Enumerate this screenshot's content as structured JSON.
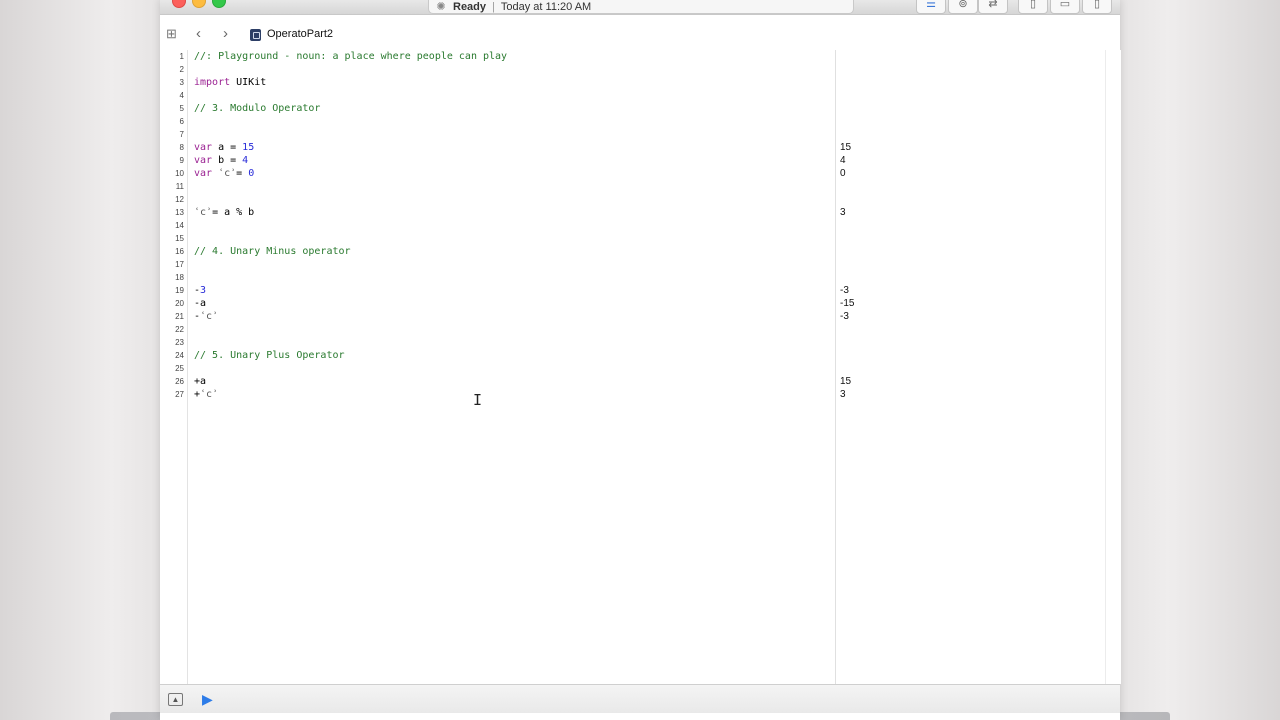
{
  "window": {
    "activity_status": "Ready",
    "activity_time": "Today at 11:20 AM"
  },
  "jumpbar": {
    "file_name": "OperatoPart2"
  },
  "editor": {
    "lines": [
      {
        "n": "1",
        "segments": [
          {
            "t": "//: Playground - noun: a place where people can play",
            "c": "comment"
          }
        ]
      },
      {
        "n": "2",
        "segments": []
      },
      {
        "n": "3",
        "segments": [
          {
            "t": "import",
            "c": "kw"
          },
          {
            "t": " UIKit",
            "c": "var"
          }
        ]
      },
      {
        "n": "4",
        "segments": []
      },
      {
        "n": "5",
        "segments": [
          {
            "t": "// 3. Modulo Operator",
            "c": "comment"
          }
        ]
      },
      {
        "n": "6",
        "segments": []
      },
      {
        "n": "7",
        "segments": []
      },
      {
        "n": "8",
        "segments": [
          {
            "t": "var",
            "c": "kw"
          },
          {
            "t": " a = ",
            "c": "var"
          },
          {
            "t": "15",
            "c": "num"
          }
        ]
      },
      {
        "n": "9",
        "segments": [
          {
            "t": "var",
            "c": "kw"
          },
          {
            "t": " b = ",
            "c": "var"
          },
          {
            "t": "4",
            "c": "num"
          }
        ]
      },
      {
        "n": "10",
        "segments": [
          {
            "t": "var",
            "c": "kw"
          },
          {
            "t": " ",
            "c": "var"
          },
          {
            "t": "ʿcʾ",
            "c": "warn"
          },
          {
            "t": "= ",
            "c": "var"
          },
          {
            "t": "0",
            "c": "num"
          }
        ]
      },
      {
        "n": "11",
        "segments": []
      },
      {
        "n": "12",
        "segments": []
      },
      {
        "n": "13",
        "segments": [
          {
            "t": "ʿcʾ",
            "c": "warn"
          },
          {
            "t": "= a % b",
            "c": "var"
          }
        ]
      },
      {
        "n": "14",
        "segments": []
      },
      {
        "n": "15",
        "segments": []
      },
      {
        "n": "16",
        "segments": [
          {
            "t": "// 4. Unary Minus operator",
            "c": "comment"
          }
        ]
      },
      {
        "n": "17",
        "segments": []
      },
      {
        "n": "18",
        "segments": []
      },
      {
        "n": "19",
        "segments": [
          {
            "t": "-",
            "c": "var"
          },
          {
            "t": "3",
            "c": "num"
          }
        ]
      },
      {
        "n": "20",
        "segments": [
          {
            "t": "-a",
            "c": "var"
          }
        ]
      },
      {
        "n": "21",
        "segments": [
          {
            "t": "-",
            "c": "var"
          },
          {
            "t": "ʿcʾ",
            "c": "warn"
          }
        ]
      },
      {
        "n": "22",
        "segments": []
      },
      {
        "n": "23",
        "segments": []
      },
      {
        "n": "24",
        "segments": [
          {
            "t": "// 5. Unary Plus Operator",
            "c": "comment"
          }
        ]
      },
      {
        "n": "25",
        "segments": []
      },
      {
        "n": "26",
        "segments": [
          {
            "t": "+a",
            "c": "var"
          }
        ]
      },
      {
        "n": "27",
        "segments": [
          {
            "t": "+",
            "c": "var"
          },
          {
            "t": "ʿcʾ",
            "c": "warn"
          }
        ]
      }
    ],
    "results": [
      {
        "line": 8,
        "value": "15"
      },
      {
        "line": 9,
        "value": "4"
      },
      {
        "line": 10,
        "value": "0"
      },
      {
        "line": 13,
        "value": "3"
      },
      {
        "line": 19,
        "value": "-3"
      },
      {
        "line": 20,
        "value": "-15"
      },
      {
        "line": 21,
        "value": "-3"
      },
      {
        "line": 26,
        "value": "15"
      },
      {
        "line": 27,
        "value": "3"
      }
    ]
  },
  "colors": {
    "comment": "#2a7a2f",
    "keyword": "#9b2393",
    "number": "#272ad8",
    "run_button": "#2d7ce8"
  },
  "icons": {
    "close": "close-window-icon",
    "minimize": "minimize-window-icon",
    "maximize": "zoom-window-icon",
    "back": "chevron-left-icon",
    "forward": "chevron-right-icon",
    "related": "related-items-grid-icon",
    "file": "swift-playground-file-icon",
    "debug_toggle": "toggle-debug-area-icon",
    "run": "run-playground-icon",
    "cursor": "text-cursor-icon"
  }
}
